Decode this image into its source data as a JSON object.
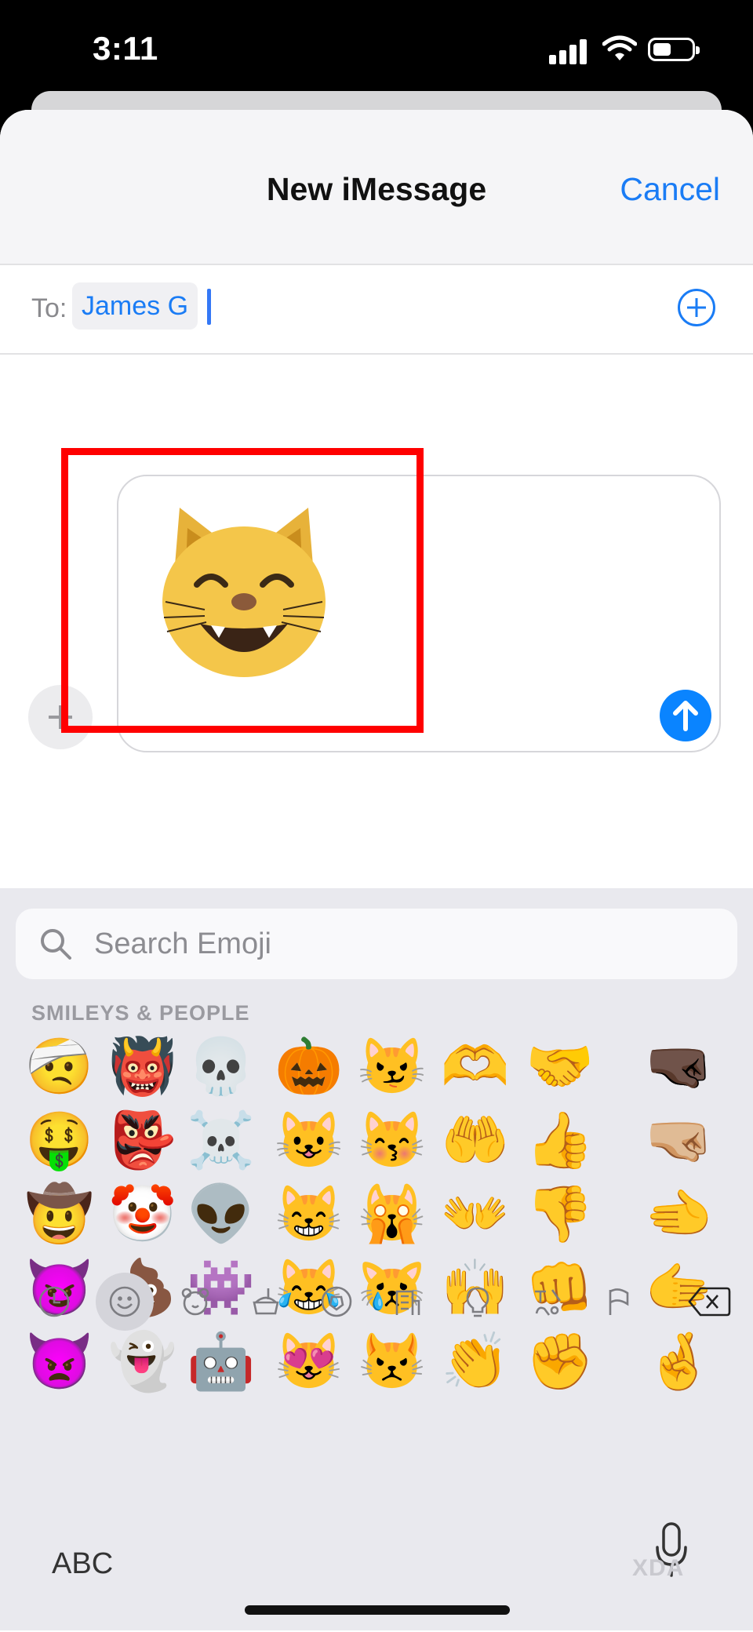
{
  "status_bar": {
    "time": "3:11"
  },
  "header": {
    "title": "New iMessage",
    "cancel_label": "Cancel"
  },
  "recipient": {
    "label": "To:",
    "name": "James G"
  },
  "composer": {
    "emoji": "😸"
  },
  "keyboard": {
    "search_placeholder": "Search Emoji",
    "section_label": "SMILEYS & PEOPLE",
    "emoji_columns": [
      [
        "🤕",
        "🤑",
        "🤠",
        "😈",
        "👿"
      ],
      [
        "👹",
        "👺",
        "🤡",
        "💩",
        "👻"
      ],
      [
        "💀",
        "☠️",
        "👽",
        "👾",
        "🤖"
      ],
      [
        "🎃",
        "😺",
        "😸",
        "😹",
        "😻"
      ],
      [
        "😼",
        "😽",
        "🙀",
        "😿",
        "😾"
      ],
      [
        "🫶",
        "🤲",
        "👐",
        "🙌",
        "👏"
      ],
      [
        "🤝",
        "👍",
        "👎",
        "👊",
        "✊"
      ],
      [
        "🤜🏿",
        "🤜🏼",
        "🫲",
        "🫱",
        "🤞"
      ]
    ],
    "categories": [
      "recent",
      "smileys",
      "animals",
      "food",
      "activity",
      "travel",
      "objects",
      "symbols",
      "flags"
    ],
    "abc_label": "ABC"
  },
  "watermark": "XDA",
  "colors": {
    "accent": "#1a7cf5",
    "highlight": "#ff0000",
    "send": "#0a84ff"
  }
}
